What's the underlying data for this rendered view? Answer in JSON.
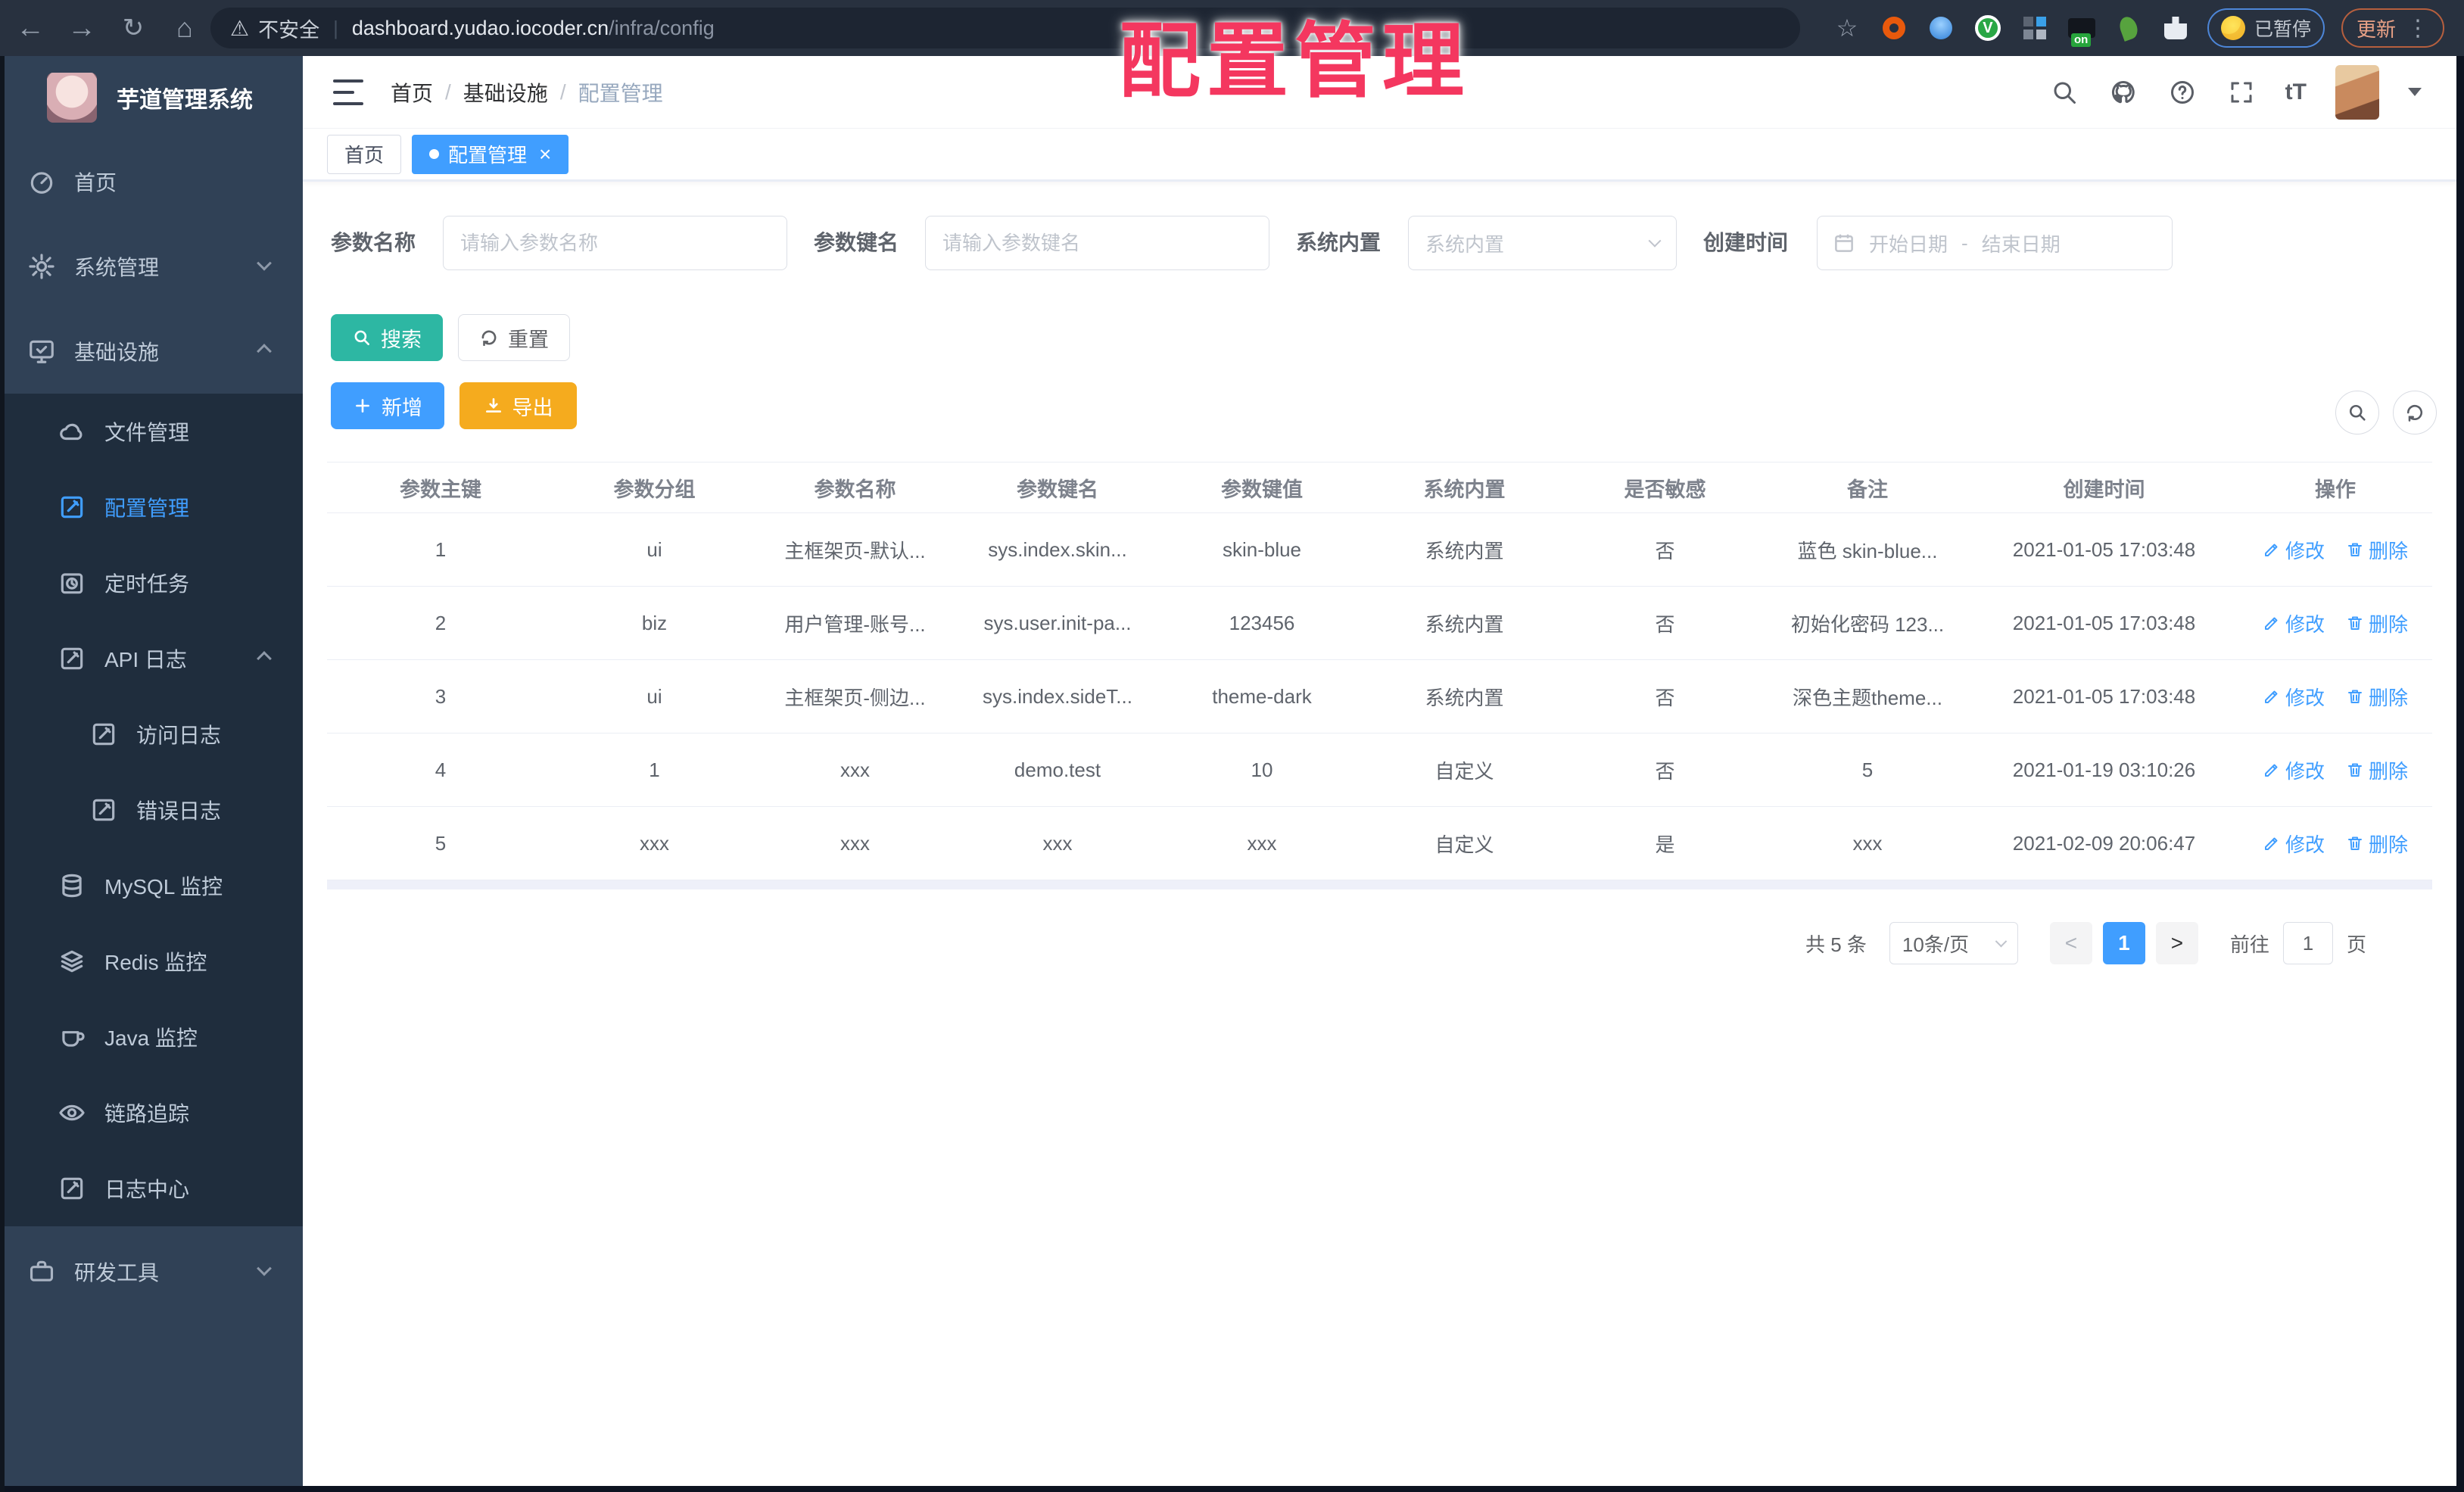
{
  "browser": {
    "security": "不安全",
    "url_host": "dashboard.yudao.iocoder.cn",
    "url_path": "/infra/config",
    "paused": "已暂停",
    "update": "更新"
  },
  "watermark": "配置管理",
  "sidebar": {
    "title": "芋道管理系统",
    "items": [
      {
        "label": "首页"
      },
      {
        "label": "系统管理"
      },
      {
        "label": "基础设施"
      },
      {
        "label": "文件管理"
      },
      {
        "label": "配置管理"
      },
      {
        "label": "定时任务"
      },
      {
        "label": "API 日志"
      },
      {
        "label": "访问日志"
      },
      {
        "label": "错误日志"
      },
      {
        "label": "MySQL 监控"
      },
      {
        "label": "Redis 监控"
      },
      {
        "label": "Java 监控"
      },
      {
        "label": "链路追踪"
      },
      {
        "label": "日志中心"
      },
      {
        "label": "研发工具"
      }
    ]
  },
  "header": {
    "breadcrumb": [
      "首页",
      "基础设施",
      "配置管理"
    ],
    "font_size_icon_label": "tT"
  },
  "tags": {
    "home": "首页",
    "current": "配置管理",
    "close": "×"
  },
  "filters": {
    "name_label": "参数名称",
    "name_placeholder": "请输入参数名称",
    "key_label": "参数键名",
    "key_placeholder": "请输入参数键名",
    "type_label": "系统内置",
    "type_placeholder": "系统内置",
    "time_label": "创建时间",
    "start_placeholder": "开始日期",
    "separator": "-",
    "end_placeholder": "结束日期"
  },
  "buttons": {
    "search": "搜索",
    "reset": "重置",
    "create": "新增",
    "export": "导出"
  },
  "table": {
    "headers": [
      "参数主键",
      "参数分组",
      "参数名称",
      "参数键名",
      "参数键值",
      "系统内置",
      "是否敏感",
      "备注",
      "创建时间",
      "操作"
    ],
    "edit": "修改",
    "delete": "删除",
    "rows": [
      {
        "cells": [
          "1",
          "ui",
          "主框架页-默认...",
          "sys.index.skin...",
          "skin-blue",
          "系统内置",
          "否",
          "蓝色 skin-blue...",
          "2021-01-05 17:03:48"
        ]
      },
      {
        "cells": [
          "2",
          "biz",
          "用户管理-账号...",
          "sys.user.init-pa...",
          "123456",
          "系统内置",
          "否",
          "初始化密码 123...",
          "2021-01-05 17:03:48"
        ]
      },
      {
        "cells": [
          "3",
          "ui",
          "主框架页-侧边...",
          "sys.index.sideT...",
          "theme-dark",
          "系统内置",
          "否",
          "深色主题theme...",
          "2021-01-05 17:03:48"
        ]
      },
      {
        "cells": [
          "4",
          "1",
          "xxx",
          "demo.test",
          "10",
          "自定义",
          "否",
          "5",
          "2021-01-19 03:10:26"
        ]
      },
      {
        "cells": [
          "5",
          "xxx",
          "xxx",
          "xxx",
          "xxx",
          "自定义",
          "是",
          "xxx",
          "2021-02-09 20:06:47"
        ]
      }
    ]
  },
  "pagination": {
    "total": "共 5 条",
    "size": "10条/页",
    "prev": "<",
    "page": "1",
    "next": ">",
    "goto": "前往",
    "goto_value": "1",
    "unit": "页"
  },
  "colors": {
    "primary": "#409eff",
    "search_teal": "#2db7a3",
    "export_yellow": "#f5ab1e",
    "sidebar_bg": "#304156",
    "submenu_bg": "#1f2d3d",
    "chrome_bg": "#28313f",
    "watermark_pink": "#f4375f"
  }
}
